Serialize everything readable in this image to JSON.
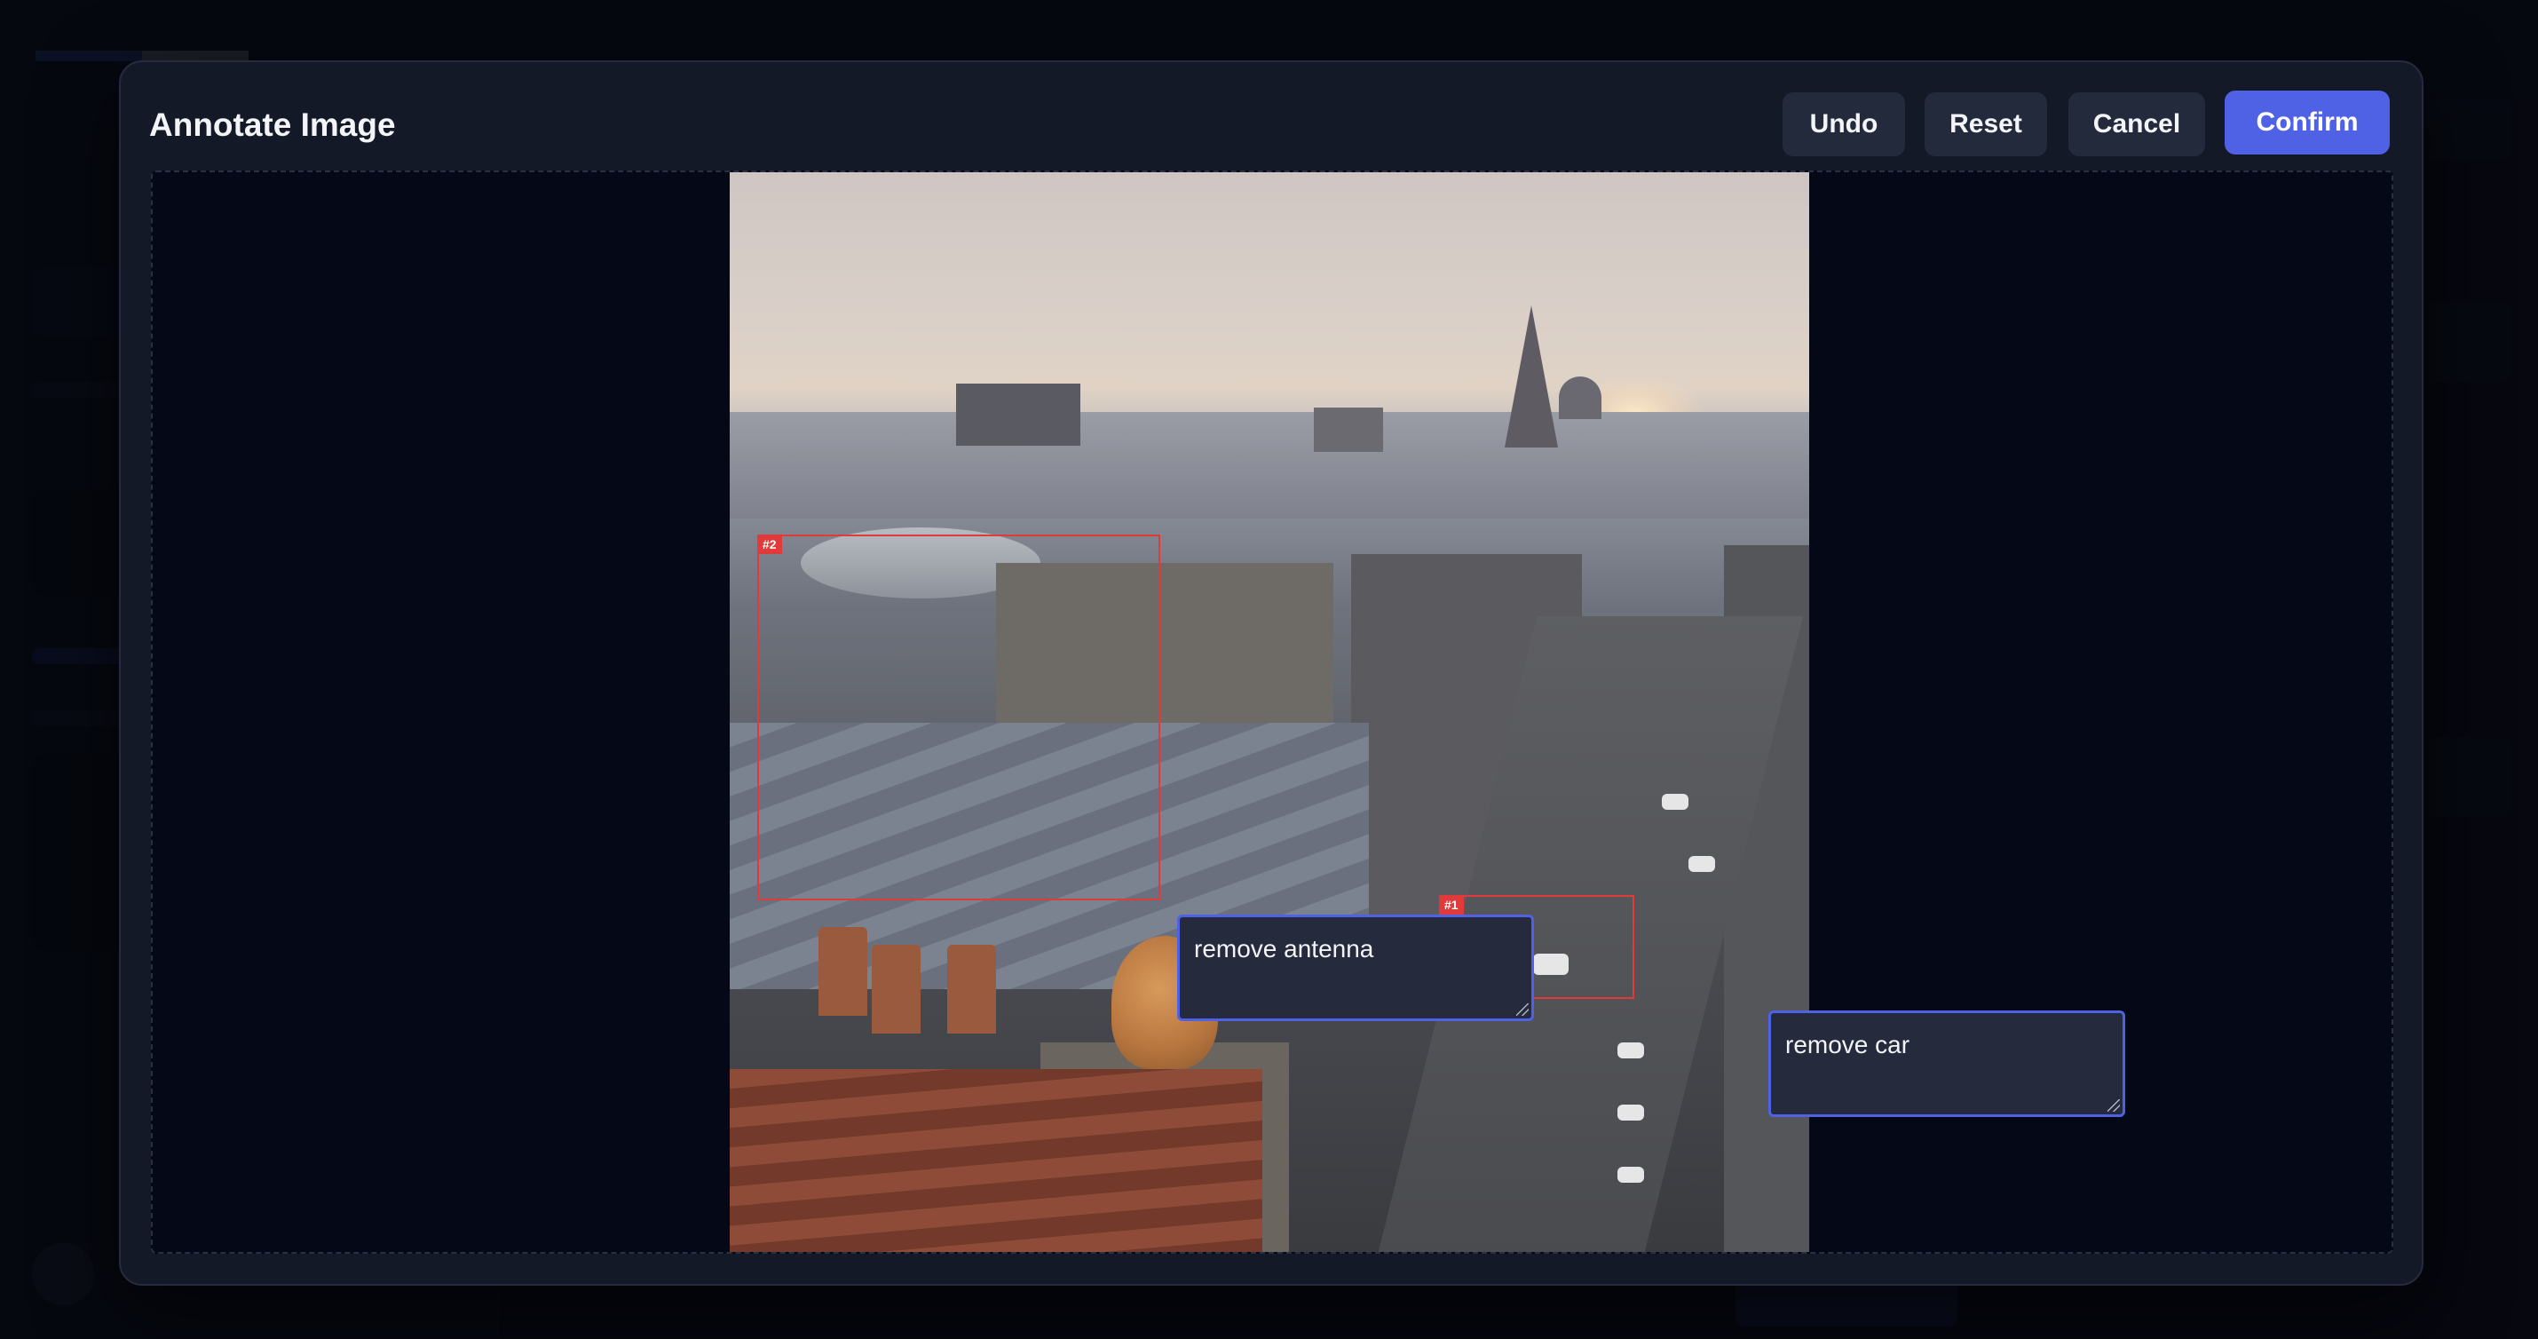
{
  "modal": {
    "title": "Annotate Image",
    "buttons": {
      "undo": "Undo",
      "reset": "Reset",
      "cancel": "Cancel",
      "confirm": "Confirm"
    },
    "accent_color": "#4f62e6",
    "annotation_color": "#e03a3a"
  },
  "annotations": [
    {
      "tag": "#1",
      "note": "remove car"
    },
    {
      "tag": "#2",
      "note": "remove antenna"
    }
  ]
}
